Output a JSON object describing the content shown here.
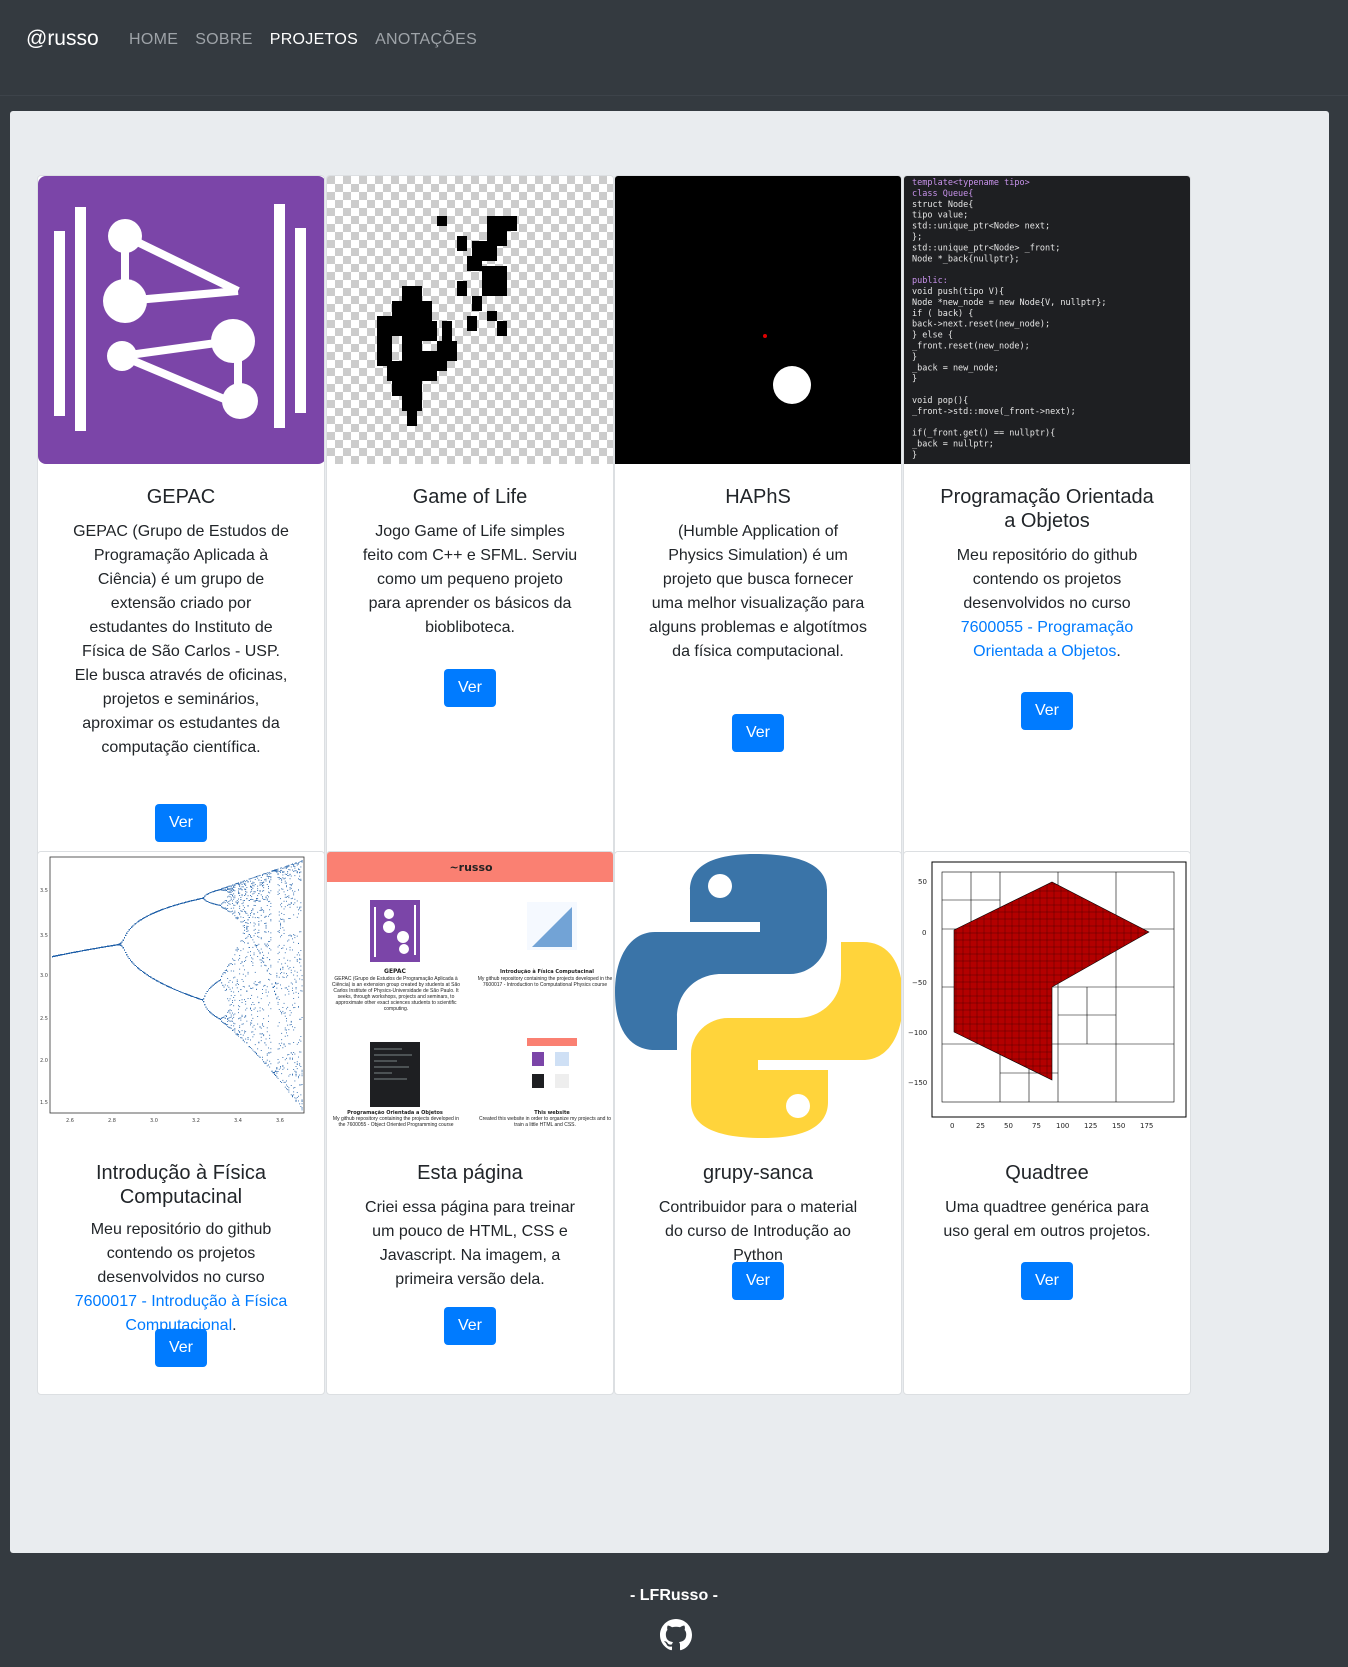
{
  "navbar": {
    "brand": "@russo",
    "links": [
      "HOME",
      "SOBRE",
      "PROJETOS",
      "ANOTAÇÕES"
    ],
    "active": "PROJETOS"
  },
  "cards": [
    {
      "title": "GEPAC",
      "text": "GEPAC (Grupo de Estudos de Programação Aplicada à Ciência) é um grupo de extensão criado por estudantes do Instituto de Física de São Carlos - USP. Ele busca através de oficinas, projetos e seminários, aproximar os estudantes da computação científica.",
      "button": "Ver"
    },
    {
      "title": "Game of Life",
      "text": "Jogo Game of Life simples feito com C++ e SFML. Serviu como um pequeno projeto para aprender os básicos da biobliboteca.",
      "button": "Ver"
    },
    {
      "title": "HAPhS",
      "text": "(Humble Application of Physics Simulation) é um projeto que busca fornecer uma melhor visualização para alguns problemas e algotítmos da física computacional.",
      "button": "Ver"
    },
    {
      "title": "Programação Orientada a Objetos",
      "text_before": "Meu repositório do github contendo os projetos desenvolvidos no curso ",
      "link": "7600055 - Programação Orientada a Objetos",
      "text_after": ".",
      "button": "Ver"
    },
    {
      "title": "Introdução à Física Computacinal",
      "text_before": "Meu repositório do github contendo os projetos desenvolvidos no curso ",
      "link": "7600017 - Introdução à Física Computacional",
      "text_after": ".",
      "button": "Ver"
    },
    {
      "title": "Esta página",
      "text": "Criei essa página para treinar um pouco de HTML, CSS e Javascript. Na imagem, a primeira versão dela.",
      "button": "Ver"
    },
    {
      "title": "grupy-sanca",
      "text": "Contribuidor para o material do curso de Introdução ao Python",
      "button": "Ver"
    },
    {
      "title": "Quadtree",
      "text": "Uma quadtree genérica para uso geral em outros projetos.",
      "button": "Ver"
    }
  ],
  "thumbnails": {
    "code": [
      "template<typename tipo>",
      "class Queue{",
      "    struct Node{",
      "        tipo value;",
      "        std::unique_ptr<Node> next;",
      "    };",
      "    std::unique_ptr<Node> _front;",
      "    Node *_back{nullptr};",
      "",
      "public:",
      "    void push(tipo V){",
      "        Node *new_node = new Node{V, nullptr};",
      "        if ( back) {",
      "            back->next.reset(new_node);",
      "        } else {",
      "            _front.reset(new_node);",
      "        }",
      "        _back = new_node;",
      "    }",
      "",
      "    void pop(){",
      "        _front->std::move(_front->next);",
      "",
      "        if(_front.get() == nullptr){",
      "            _back = nullptr;",
      "        }"
    ],
    "bifurcation": {
      "yticks": [
        "3.5",
        "3.5",
        "3.0",
        "2.5",
        "2.0",
        "1.5"
      ],
      "xticks": [
        "2.6",
        "2.8",
        "3.0",
        "3.2",
        "3.4",
        "3.6"
      ]
    },
    "esta_pagina": {
      "header": "~russo",
      "card1_title": "GEPAC",
      "card1_text": "GEPAC (Grupo de Estudos de Programação Aplicada à Ciência) is an extension group created by students at São Carlos Institute of Physics-Universidade de São Paulo. It seeks, through workshops, projects and seminars, to approximate other exact sciences students to scientific computing.",
      "card2_title": "Introdução à Física Computacinal",
      "card2_text": "My github repository containing the projects developed in the 7600017 - Introduction to Computational Physics course",
      "card3_title": "Programação Orientada a Objetos",
      "card3_text": "My github repository containing the projects developed in the 7600055 - Object Oriented Programming course",
      "card4_title": "This website",
      "card4_text": "Created this website in order to organize my projects and to train a little HTML and CSS."
    },
    "quadtree": {
      "yticks": [
        "50",
        "0",
        "−50",
        "−100",
        "−150"
      ],
      "xticks": [
        "0",
        "25",
        "50",
        "75",
        "100",
        "125",
        "150",
        "175"
      ]
    }
  },
  "footer": {
    "text": "- LFRusso -"
  },
  "colors": {
    "background": "#343a40",
    "main": "#e9ecef",
    "button": "#007bff",
    "link": "#007bff",
    "gepac_purple": "#7b45a8",
    "esta_header": "#fa8072",
    "quadtree_red": "#b30000",
    "python_blue": "#3a74a8",
    "python_yellow": "#ffd43b"
  }
}
